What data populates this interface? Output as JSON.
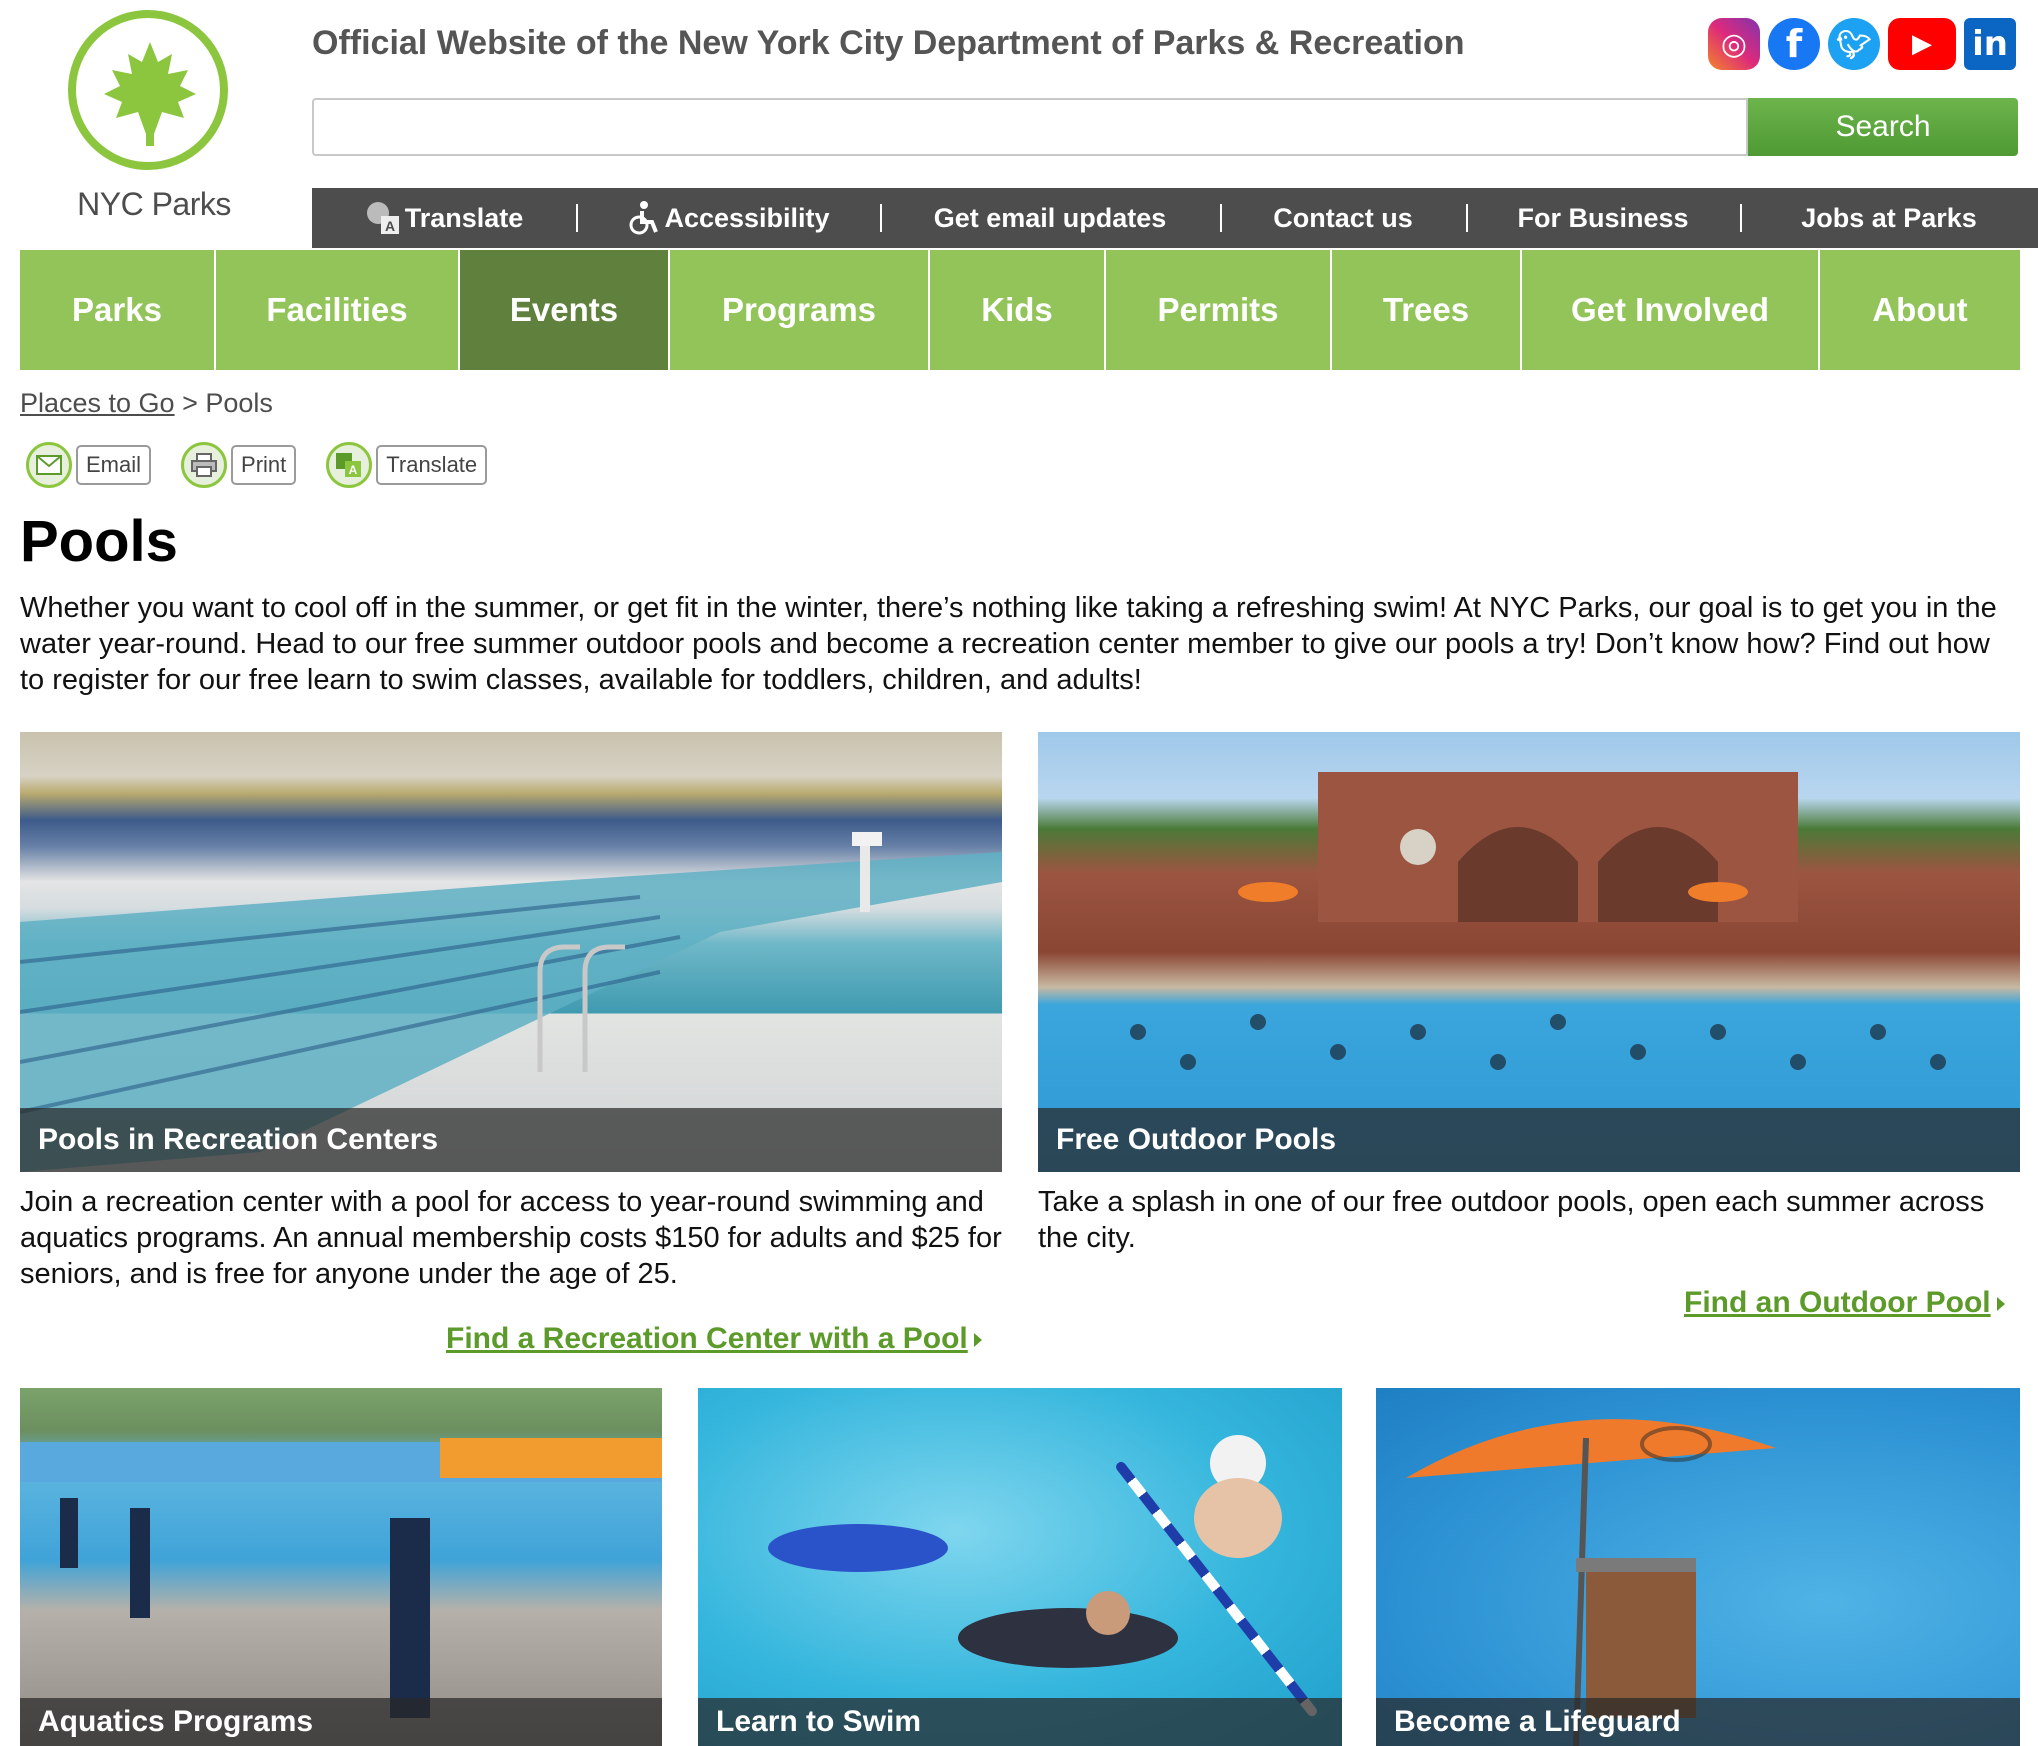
{
  "header": {
    "logo_text": "NYC Parks",
    "site_title": "Official Website of the New York City Department of Parks & Recreation",
    "social_icons": [
      "instagram-icon",
      "facebook-icon",
      "twitter-icon",
      "youtube-icon",
      "linkedin-icon"
    ],
    "search": {
      "placeholder": "",
      "button_label": "Search"
    },
    "utility_links": [
      {
        "label": "Translate",
        "icon": "translate-icon"
      },
      {
        "label": "Accessibility",
        "icon": "accessibility-icon"
      },
      {
        "label": "Get email updates"
      },
      {
        "label": "Contact us"
      },
      {
        "label": "For Business"
      },
      {
        "label": "Jobs at Parks"
      }
    ]
  },
  "nav": {
    "items": [
      "Parks",
      "Facilities",
      "Events",
      "Programs",
      "Kids",
      "Permits",
      "Trees",
      "Get Involved",
      "About"
    ],
    "active": "Events"
  },
  "breadcrumb": {
    "parent": "Places to Go",
    "separator": ">",
    "current": "Pools"
  },
  "tools": {
    "email": "Email",
    "print": "Print",
    "translate": "Translate"
  },
  "page": {
    "title": "Pools",
    "intro": "Whether you want to cool off in the summer, or get fit in the winter, there’s nothing like taking a refreshing swim! At NYC Parks, our goal is to get you in the water year-round. Head to our free summer outdoor pools and become a recreation center member to give our pools a try! Don’t know how? Find out how to register for our free learn to swim classes, available for toddlers, children, and adults!"
  },
  "cards": [
    {
      "caption": "Pools in Recreation Centers",
      "description": "Join a recreation center with a pool for access to year-round swimming and aquatics programs. An annual membership costs $150 for adults and $25 for seniors, and is free for anyone under the age of 25.",
      "link": "Find a Recreation Center with a Pool"
    },
    {
      "caption": "Free Outdoor Pools",
      "description": "Take a splash in one of our free outdoor pools, open each summer across the city.",
      "link": "Find an Outdoor Pool"
    },
    {
      "caption": "Aquatics Programs"
    },
    {
      "caption": "Learn to Swim"
    },
    {
      "caption": "Become a Lifeguard"
    }
  ],
  "colors": {
    "brand_green": "#8cc63f",
    "nav_green": "#92c45a",
    "nav_active": "#60813e",
    "utility_bar": "#4d4d4d",
    "link_green": "#5c9a2a"
  }
}
